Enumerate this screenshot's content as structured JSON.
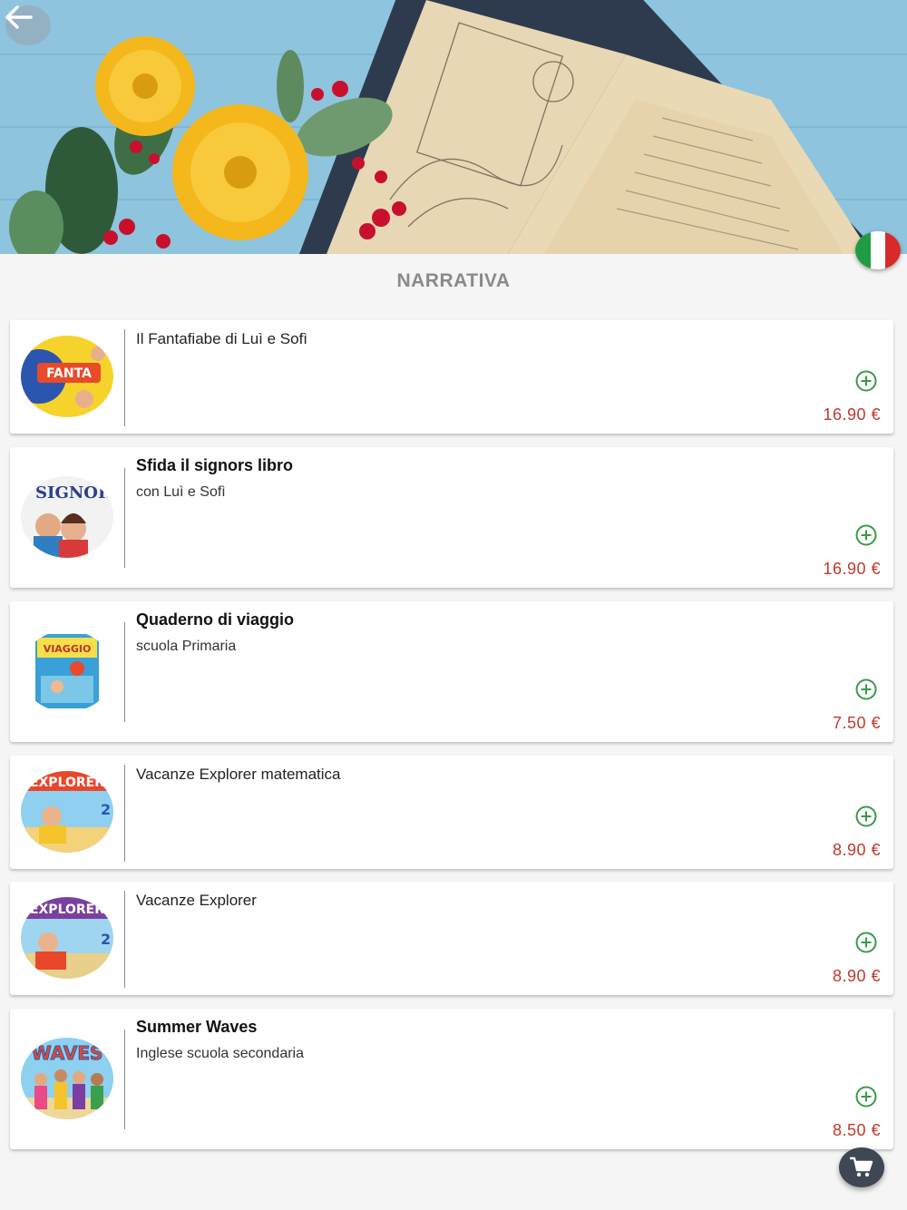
{
  "header": {
    "back_icon": "arrow-left-icon",
    "language_icon": "italy-flag-icon"
  },
  "section_title": "NARRATIVA",
  "products": [
    {
      "title": "Il Fantafiabe di Luì e Sofì",
      "subtitle": "",
      "price": "16.90 €",
      "bold": false,
      "cover_icon": "fantafiabe-cover"
    },
    {
      "title": "Sfida il signors libro",
      "subtitle": "con Luì e Sofì",
      "price": "16.90 €",
      "bold": true,
      "cover_icon": "signor-cover"
    },
    {
      "title": "Quaderno di viaggio",
      "subtitle": "scuola Primaria",
      "price": "7.50 €",
      "bold": true,
      "cover_icon": "quaderno-cover"
    },
    {
      "title": "Vacanze Explorer matematica",
      "subtitle": "",
      "price": "8.90 €",
      "bold": false,
      "cover_icon": "explorer-cover"
    },
    {
      "title": "Vacanze Explorer",
      "subtitle": "",
      "price": "8.90 €",
      "bold": false,
      "cover_icon": "explorer-cover"
    },
    {
      "title": "Summer Waves",
      "subtitle": "Inglese scuola secondaria",
      "price": "8.50 €",
      "bold": true,
      "cover_icon": "waves-cover"
    }
  ],
  "cart_icon": "shopping-cart-icon",
  "colors": {
    "price": "#c0392b",
    "add_icon": "#3a9a4a",
    "fab": "#3e4753",
    "title": "#8a8a8a"
  }
}
